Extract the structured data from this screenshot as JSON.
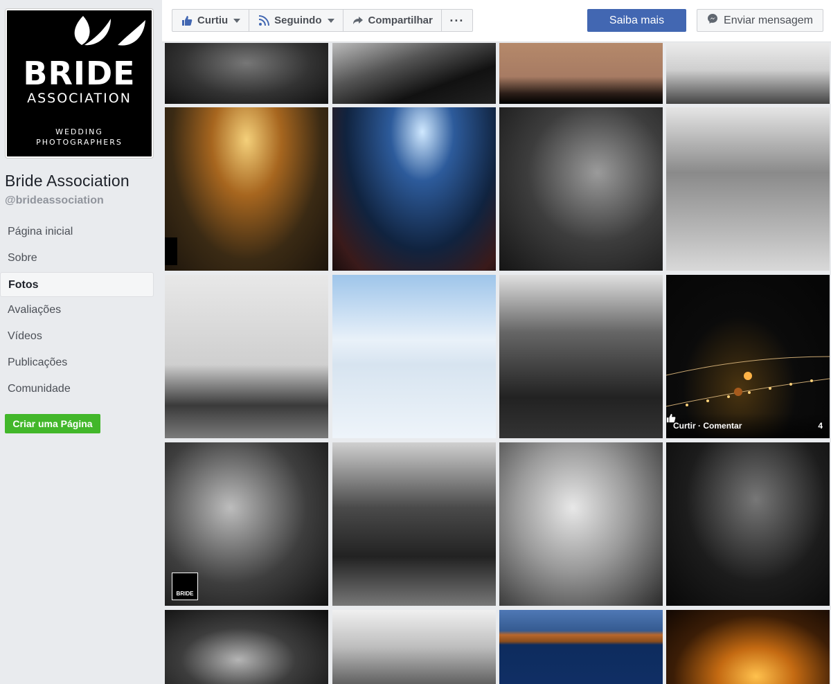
{
  "sidebar": {
    "logo": {
      "main": "BRIDE",
      "sub": "ASSOCIATION",
      "tagline": "WEDDING\nPHOTOGRAPHERS"
    },
    "page_name": "Bride Association",
    "handle": "@brideassociation",
    "nav": [
      {
        "label": "Página inicial",
        "active": false
      },
      {
        "label": "Sobre",
        "active": false
      },
      {
        "label": "Fotos",
        "active": true
      },
      {
        "label": "Avaliações",
        "active": false
      },
      {
        "label": "Vídeos",
        "active": false
      },
      {
        "label": "Publicações",
        "active": false
      },
      {
        "label": "Comunidade",
        "active": false
      }
    ],
    "create_page_label": "Criar uma Página"
  },
  "topbar": {
    "liked_label": "Curtiu",
    "following_label": "Seguindo",
    "share_label": "Compartilhar",
    "more_label": "···",
    "learn_more_label": "Saiba mais",
    "send_message_label": "Enviar mensagem"
  },
  "colors": {
    "primary": "#4267b2",
    "create_green": "#42b72a",
    "background": "#e9ebee"
  },
  "photos": {
    "hover_overlay": {
      "photo_index": 11,
      "like_label": "Curtir",
      "separator": "·",
      "comment_label": "Comentar",
      "like_count": "4"
    },
    "watermark_label": "BRIDE"
  }
}
